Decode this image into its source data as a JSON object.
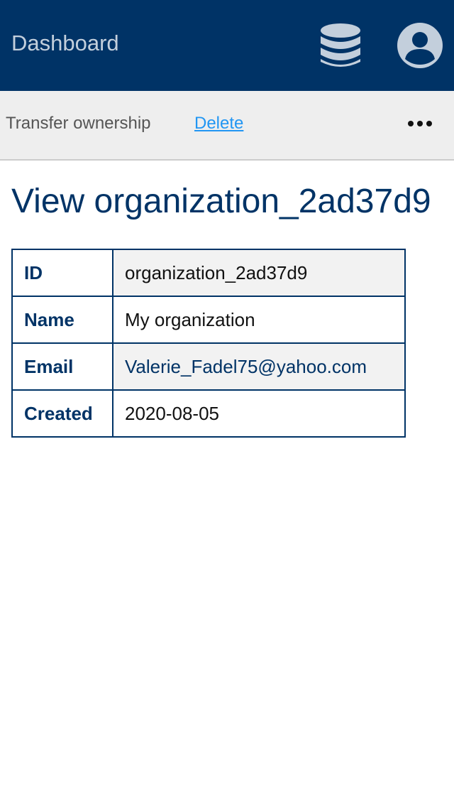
{
  "header": {
    "brand": "Dashboard",
    "icons": {
      "database": "database-icon",
      "account": "account-circle-icon"
    },
    "colors": {
      "background": "#003366",
      "icon": "#c3cfdc"
    }
  },
  "actions": {
    "transfer_label": "Transfer ownership",
    "delete_label": "Delete",
    "more_icon": "more-horizontal-icon"
  },
  "page": {
    "title": "View organization_2ad37d9"
  },
  "details": {
    "rows": [
      {
        "key": "ID",
        "value": "organization_2ad37d9"
      },
      {
        "key": "Name",
        "value": "My organization"
      },
      {
        "key": "Email",
        "value": "Valerie_Fadel75@yahoo.com"
      },
      {
        "key": "Created",
        "value": "2020-08-05"
      }
    ]
  }
}
